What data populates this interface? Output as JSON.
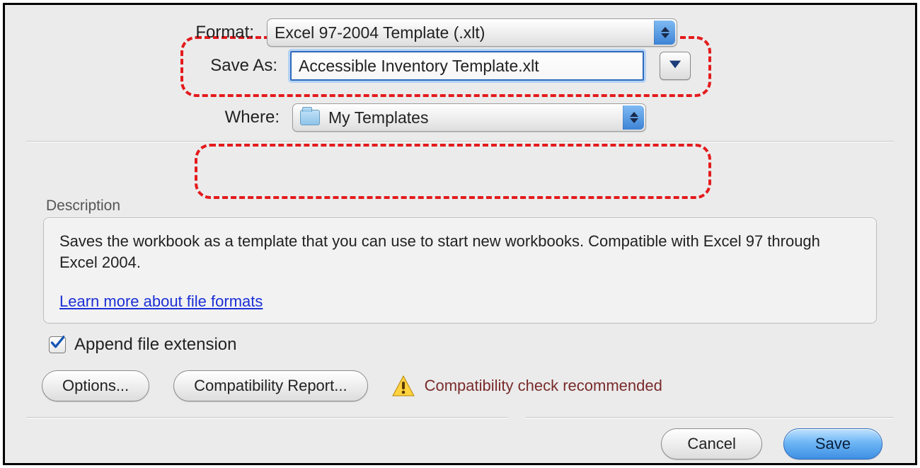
{
  "save_as": {
    "label": "Save As:",
    "value": "Accessible Inventory Template.xlt"
  },
  "where": {
    "label": "Where:",
    "value": "My Templates"
  },
  "format": {
    "label": "Format:",
    "value": "Excel 97-2004 Template (.xlt)"
  },
  "description": {
    "heading": "Description",
    "text": "Saves the workbook as a template that you can use to start new workbooks. Compatible with Excel 97 through Excel 2004.",
    "link": "Learn more about file formats"
  },
  "append_extension": {
    "label": "Append file extension",
    "checked": true
  },
  "buttons": {
    "options": "Options...",
    "compat_report": "Compatibility Report...",
    "compat_warning": "Compatibility check recommended",
    "cancel": "Cancel",
    "save": "Save"
  }
}
